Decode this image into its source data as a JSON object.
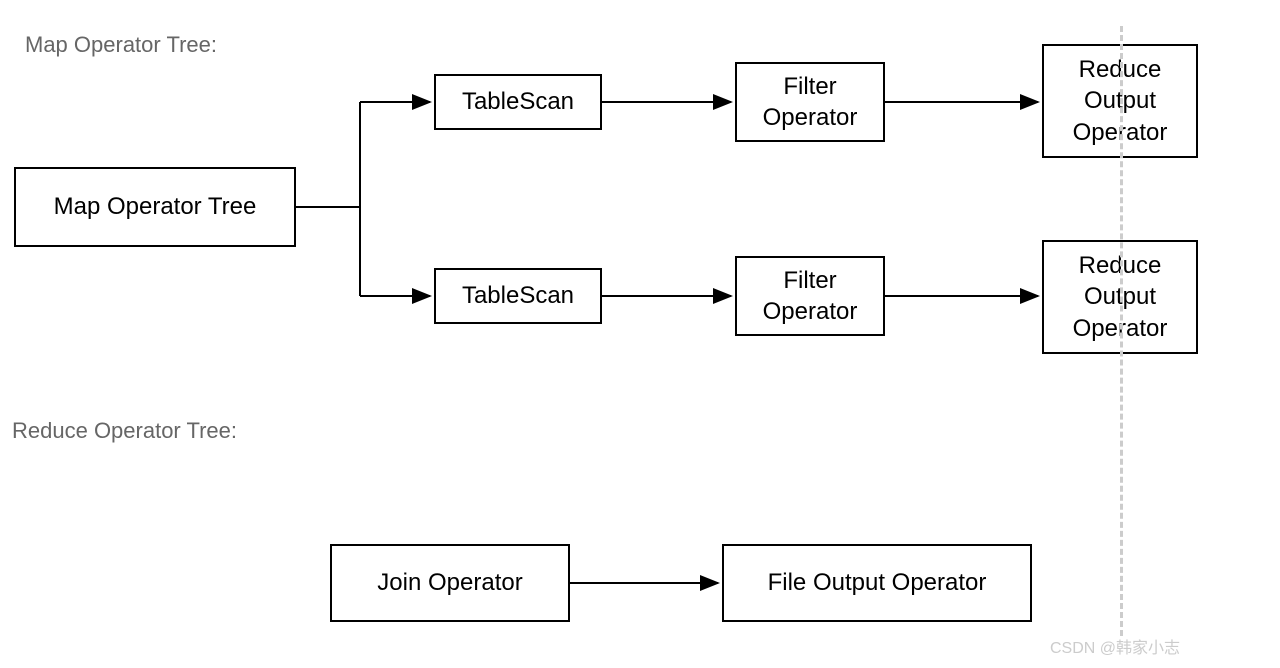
{
  "labels": {
    "map_tree": "Map Operator Tree:",
    "reduce_tree": "Reduce Operator Tree:"
  },
  "boxes": {
    "map_root": "Map Operator Tree",
    "tablescan1": "TableScan",
    "tablescan2": "TableScan",
    "filter1": "Filter Operator",
    "filter2": "Filter Operator",
    "reduce_out1": "Reduce Output Operator",
    "reduce_out2": "Reduce Output Operator",
    "join_op": "Join Operator",
    "file_out": "File Output Operator"
  },
  "watermark": "CSDN @韩家小志"
}
